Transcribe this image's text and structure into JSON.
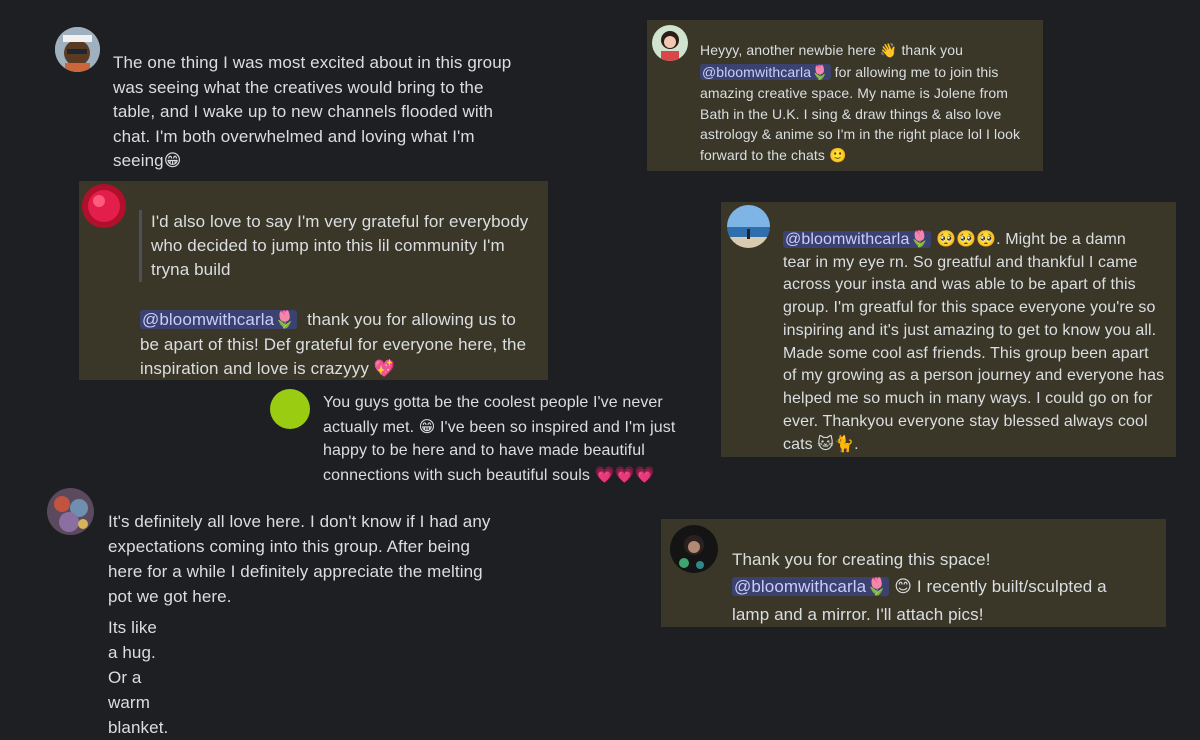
{
  "colors": {
    "background": "#1e1f22",
    "highlight": "#3a3729",
    "text": "#dbdee1",
    "mention_bg": "#3c4270",
    "mention_text": "#c9cdfb"
  },
  "mention_handle": "@bloomwithcarla",
  "mention_emoji": "🌷",
  "messages": {
    "m1": {
      "lines": [
        "The one thing I was most excited about in this group",
        "was seeing what the creatives would bring to the",
        "table, and I wake up to new channels flooded with",
        "chat. I'm both overwhelmed and loving what I'm"
      ],
      "last": "seeing",
      "emoji": "😁"
    },
    "m2": {
      "lines": [
        "Heyyy, another newbie here",
        "for allowing me to join this",
        "amazing creative space. My name is Jolene from",
        "Bath in the U.K. I sing & draw things & also love",
        "astrology & anime so I'm in the right place lol I look",
        "forward to the chats"
      ],
      "wave": "👋",
      "thank": "thank you",
      "smile": "🙂"
    },
    "m3": {
      "quote_lines": [
        "I'd also love to say I'm very grateful for everybody",
        "who decided to jump into this lil community I'm",
        "tryna build"
      ],
      "after_mention": "thank you for allowing us to",
      "lines": [
        "be apart of this! Def grateful for everyone here, the",
        "inspiration and love is crazyyy"
      ],
      "emoji": "💖"
    },
    "m4": {
      "after_mention": ". Might be a damn",
      "pleading": "🥺🥺🥺",
      "lines": [
        "tear in my eye rn.  So greatful and thankful I came",
        "across your insta and was able to be apart of this",
        "group. I'm greatful for this space  everyone you're so",
        "inspiring and it's just amazing to get to know you all.",
        "Made some cool asf friends. This group been apart",
        "of my growing as a person journey and everyone has",
        "helped me so much in many ways. I could go on for",
        "ever. Thankyou everyone stay blessed always cool",
        "cats"
      ],
      "cats": "🐱🐈",
      "end": "."
    },
    "m5": {
      "lines": [
        "You guys gotta be the coolest people I've never",
        "actually met.",
        "I've been so inspired and I'm just",
        "happy to be here and to have made beautiful",
        "connections with such beautiful souls"
      ],
      "grin": "😁",
      "hearts": "💗💗💗"
    },
    "m6": {
      "lines": [
        "It's definitely all love here. I don't know if I had any",
        "expectations coming into this group. After being",
        "here for a while I definitely appreciate the melting",
        "pot we got here."
      ],
      "followup": "Its like a hug. Or a warm blanket."
    },
    "m7": {
      "line1": "Thank you for creating this space!",
      "smile": "😊",
      "after_mention": "I recently built/sculpted a",
      "line3": "lamp and a mirror. I'll attach pics!"
    }
  }
}
